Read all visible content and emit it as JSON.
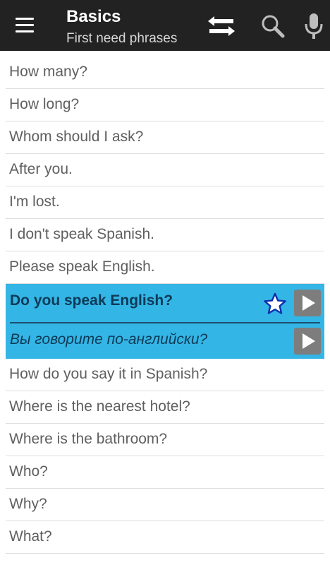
{
  "header": {
    "title": "Basics",
    "subtitle": "First need phrases",
    "icons": [
      "menu-icon",
      "swap-icon",
      "search-icon",
      "mic-icon"
    ]
  },
  "phrases_before": [
    "How many?",
    "How long?",
    "Whom should I ask?",
    "After you.",
    "I'm lost.",
    "I don't speak Spanish.",
    "Please speak English."
  ],
  "selected": {
    "phrase": "Do you speak English?",
    "translation": "Вы говорите по-английски?",
    "favorite_icon": "star-icon",
    "play_icon": "play-icon"
  },
  "phrases_after": [
    "How do you say it in Spanish?",
    "Where is the nearest hotel?",
    "Where is the bathroom?",
    "Who?",
    "Why?",
    "What?"
  ],
  "colors": {
    "appbar": "#222222",
    "selected_background": "#33b5e5",
    "selected_text": "#0e3a57",
    "row_text": "#5f5f5f",
    "star_fill": "#ffffff",
    "star_stroke": "#0a2fb0",
    "play_button": "#7d7d7d"
  }
}
